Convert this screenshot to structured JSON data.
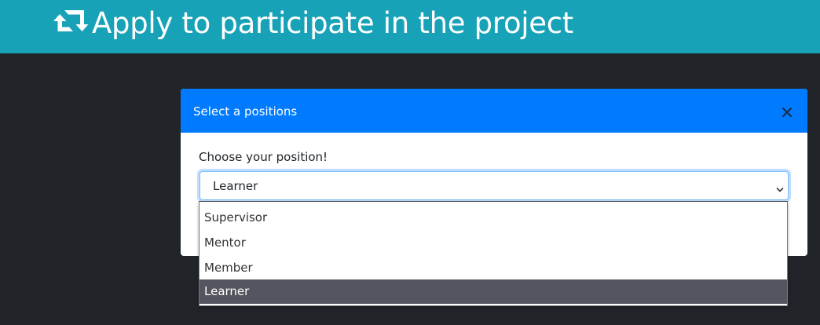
{
  "header": {
    "title": "Apply to participate in the project",
    "icon": "retweet-icon",
    "background": "#17a2b8"
  },
  "modal": {
    "title": "Select a positions",
    "header_color": "#007bff",
    "close_icon": "close-icon",
    "field_label": "Choose your position!",
    "select": {
      "value": "Learner",
      "options": [
        "Supervisor",
        "Mentor",
        "Member",
        "Learner"
      ],
      "highlighted": "Learner"
    }
  },
  "colors": {
    "page_background": "#212529",
    "highlight": "#55555f"
  }
}
